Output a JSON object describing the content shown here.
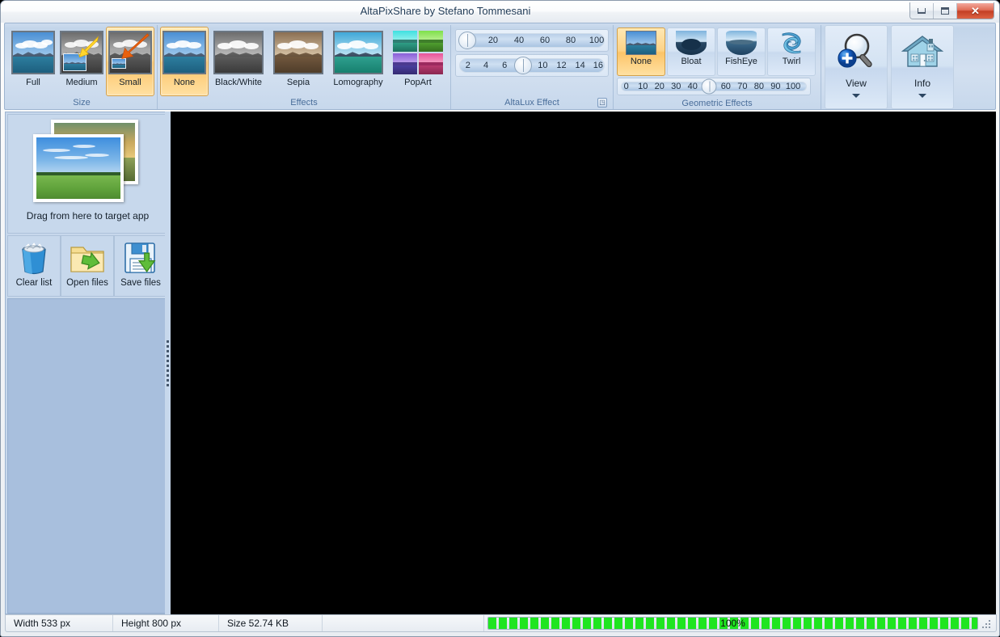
{
  "window": {
    "title": "AltaPixShare by Stefano Tommesani",
    "buttons": {
      "minimize": {
        "name": "minimize",
        "glyph": "minimize-icon"
      },
      "maximize": {
        "name": "restore",
        "glyph": "restore-icon"
      },
      "close": {
        "name": "close",
        "glyph": "✕"
      }
    }
  },
  "ribbon": {
    "groups": [
      {
        "id": "size",
        "label": "Size",
        "items": [
          {
            "label": "Full",
            "selected": false,
            "icon": "thumbnail-full"
          },
          {
            "label": "Medium",
            "selected": false,
            "icon": "thumbnail-medium"
          },
          {
            "label": "Small",
            "selected": true,
            "icon": "thumbnail-small"
          }
        ]
      },
      {
        "id": "effects",
        "label": "Effects",
        "items": [
          {
            "label": "None",
            "selected": true,
            "icon": "thumbnail-none"
          },
          {
            "label": "Black/White",
            "selected": false,
            "icon": "thumbnail-blackwhite"
          },
          {
            "label": "Sepia",
            "selected": false,
            "icon": "thumbnail-sepia"
          },
          {
            "label": "Lomography",
            "selected": false,
            "icon": "thumbnail-lomography"
          },
          {
            "label": "PopArt",
            "selected": false,
            "icon": "thumbnail-popart"
          }
        ]
      },
      {
        "id": "altalux",
        "label": "AltaLux Effect",
        "launcher": "◳",
        "sliders": [
          {
            "name": "altalux-strength-slider",
            "ticks": [
              "0",
              "20",
              "40",
              "60",
              "80",
              "100"
            ],
            "value": 0,
            "min": 0,
            "max": 100
          },
          {
            "name": "altalux-scale-slider",
            "ticks": [
              "2",
              "4",
              "6",
              "8",
              "10",
              "12",
              "14",
              "16"
            ],
            "value": 8,
            "min": 2,
            "max": 16
          }
        ]
      },
      {
        "id": "geometric",
        "label": "Geometric Effects",
        "items": [
          {
            "label": "None",
            "selected": true,
            "icon": "geo-none"
          },
          {
            "label": "Bloat",
            "selected": false,
            "icon": "geo-bloat"
          },
          {
            "label": "FishEye",
            "selected": false,
            "icon": "geo-fisheye"
          },
          {
            "label": "Twirl",
            "selected": false,
            "icon": "geo-twirl"
          }
        ],
        "slider": {
          "name": "geometric-amount-slider",
          "ticks": [
            "0",
            "10",
            "20",
            "30",
            "40",
            "50",
            "60",
            "70",
            "80",
            "90",
            "100"
          ],
          "value": 50,
          "min": 0,
          "max": 100
        }
      },
      {
        "id": "view",
        "buttons": [
          {
            "label": "View",
            "icon": "magnifier-plus-icon",
            "caret": true
          },
          {
            "label": "Info",
            "icon": "house-icon",
            "caret": true
          }
        ]
      }
    ]
  },
  "sidebar": {
    "drag_area": {
      "caption": "Drag from here to target app",
      "icon": "photo-stack-icon"
    },
    "commands": [
      {
        "label": "Clear list",
        "icon": "trash-can-icon"
      },
      {
        "label": "Open files",
        "icon": "open-folder-icon"
      },
      {
        "label": "Save files",
        "icon": "floppy-save-icon"
      }
    ],
    "file_list_items": []
  },
  "canvas": {
    "background": "#000000"
  },
  "statusbar": {
    "cells": [
      {
        "name": "width-status",
        "text": "Width 533 px"
      },
      {
        "name": "height-status",
        "text": "Height 800 px"
      },
      {
        "name": "size-status",
        "text": "Size 52.74 KB"
      },
      {
        "name": "spacer-status",
        "text": ""
      }
    ],
    "progress": {
      "percent": 100,
      "label": "100%",
      "color": "#1fe520"
    }
  },
  "colors": {
    "ribbon_bg": "#cddcee",
    "accent_selected": "#fdd286",
    "sidebar_bg": "#c7d8ec",
    "filelist_bg": "#a8bfdd",
    "canvas": "#000000",
    "group_label": "#4a6e9a"
  }
}
